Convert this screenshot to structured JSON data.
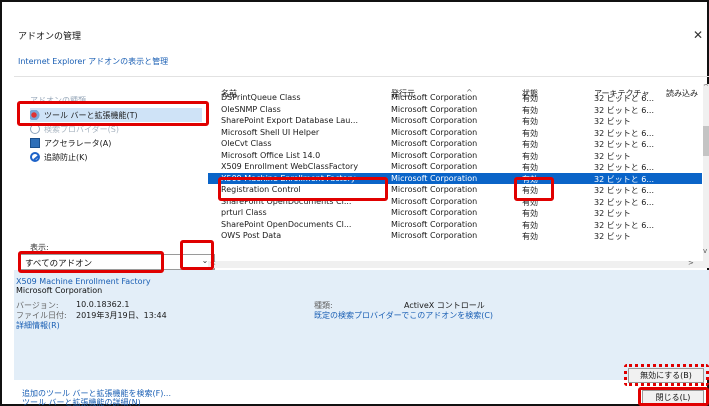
{
  "dialog": {
    "title": "アドオンの管理",
    "close_glyph": "✕",
    "subtitle": "Internet Explorer アドオンの表示と管理"
  },
  "sidebar": {
    "group_label": "アドオンの種類",
    "items": [
      {
        "label": "ツール バーと拡張機能(T)",
        "icon": "toolbar-extension-icon"
      },
      {
        "label": "検索プロバイダー(S)",
        "icon": "search-provider-icon"
      },
      {
        "label": "アクセラレータ(A)",
        "icon": "accelerator-icon"
      },
      {
        "label": "追跡防止(K)",
        "icon": "tracking-protection-icon"
      }
    ],
    "show_label": "表示:",
    "show_value": "すべてのアドオン",
    "show_arrow": "⌄"
  },
  "table": {
    "columns": [
      "名前",
      "発行元",
      "状態",
      "アーキテクチャ",
      "読み込み"
    ],
    "sort_glyph": "^",
    "rows": [
      {
        "name": "DSPrintQueue Class",
        "publisher": "Microsoft Corporation",
        "status": "有効",
        "arch": "32 ビットと 6..."
      },
      {
        "name": "OleSNMP Class",
        "publisher": "Microsoft Corporation",
        "status": "有効",
        "arch": "32 ビットと 6..."
      },
      {
        "name": "SharePoint Export Database Lau...",
        "publisher": "Microsoft Corporation",
        "status": "有効",
        "arch": "32 ビット"
      },
      {
        "name": "Microsoft Shell UI Helper",
        "publisher": "Microsoft Corporation",
        "status": "有効",
        "arch": "32 ビットと 6..."
      },
      {
        "name": "OleCvt Class",
        "publisher": "Microsoft Corporation",
        "status": "有効",
        "arch": "32 ビットと 6..."
      },
      {
        "name": "Microsoft Office List 14.0",
        "publisher": "Microsoft Corporation",
        "status": "有効",
        "arch": "32 ビット"
      },
      {
        "name": "X509 Enrollment WebClassFactory",
        "publisher": "Microsoft Corporation",
        "status": "有効",
        "arch": "32 ビットと 6..."
      },
      {
        "name": "X509 Machine Enrollment Factory",
        "publisher": "Microsoft Corporation",
        "status": "有効",
        "arch": "32 ビットと 6..."
      },
      {
        "name": "Registration Control",
        "publisher": "Microsoft Corporation",
        "status": "有効",
        "arch": "32 ビットと 6..."
      },
      {
        "name": "SharePoint OpenDocuments Cl...",
        "publisher": "Microsoft Corporation",
        "status": "有効",
        "arch": "32 ビットと 6..."
      },
      {
        "name": "prturl Class",
        "publisher": "Microsoft Corporation",
        "status": "有効",
        "arch": "32 ビット"
      },
      {
        "name": "SharePoint OpenDocuments Cl...",
        "publisher": "Microsoft Corporation",
        "status": "有効",
        "arch": "32 ビットと 6..."
      },
      {
        "name": "OWS Post Data",
        "publisher": "Microsoft Corporation",
        "status": "有効",
        "arch": "32 ビット"
      }
    ],
    "scroll_left": "<",
    "scroll_right": ">",
    "scroll_up": "^",
    "scroll_down": "v"
  },
  "details": {
    "name": "X509 Machine Enrollment Factory",
    "publisher": "Microsoft Corporation",
    "version_label": "バージョン:",
    "version_value": "10.0.18362.1",
    "date_label": "ファイル日付:",
    "date_value": "2019年3月19日、13:44",
    "more_info": "詳細情報(R)",
    "type_label": "種類:",
    "type_value": "ActiveX コントロール",
    "search_link": "既定の検索プロバイダーでこのアドオンを検索(C)"
  },
  "footer": {
    "find_more": "追加のツール バーと拡張機能を検索(F)...",
    "learn_more": "ツール バーと拡張機能の詳細(N)",
    "disable_button": "無効にする(B)",
    "close_button": "閉じる(L)"
  },
  "colors": {
    "highlight": "#e00000",
    "selection": "#0a64c8",
    "link": "#1a5fb4",
    "details_bg": "#e3eef8"
  }
}
